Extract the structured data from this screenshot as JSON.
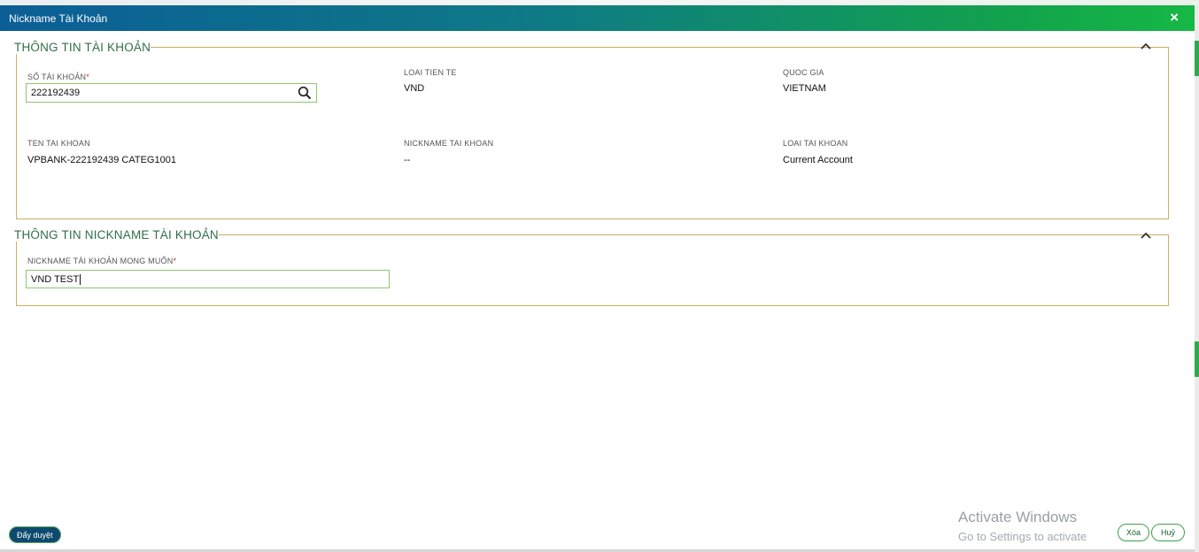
{
  "dialog": {
    "title": "Nickname Tài Khoản",
    "close_icon": "×"
  },
  "account_info": {
    "section_title": "THÔNG TIN TÀI KHOẢN",
    "account_number": {
      "label": "SỐ TÀI KHOẢN",
      "required_mark": "*",
      "value": "222192439"
    },
    "currency": {
      "label": "LOAI TIEN TE",
      "value": "VND"
    },
    "country": {
      "label": "QUOC GIA",
      "value": "VIETNAM"
    },
    "account_name": {
      "label": "TEN TAI KHOAN",
      "value": "VPBANK-222192439 CATEG1001"
    },
    "account_nickname": {
      "label": "NICKNAME TAI KHOAN",
      "value": "--"
    },
    "account_type": {
      "label": "LOAI TAI KHOAN",
      "value": "Current Account"
    }
  },
  "nickname_info": {
    "section_title": "THÔNG TIN NICKNAME TÀI KHOẢN",
    "desired_nickname": {
      "label": "NICKNAME TÀI KHOẢN MONG MUỐN",
      "required_mark": "*",
      "value": "VND TEST"
    }
  },
  "actions": {
    "submit_label": "Đẩy duyệt",
    "delete_label": "Xóa",
    "cancel_label": "Huỷ"
  },
  "watermark": {
    "title": "Activate Windows",
    "subtitle": "Go to Settings to activate"
  },
  "icons": {
    "collapse": "chevron-up-icon",
    "search": "search-icon",
    "close": "close-icon"
  },
  "colors": {
    "title_gradient_start": "#0b5e96",
    "title_gradient_end": "#16b845",
    "section_border": "#c9b062",
    "section_title": "#2f6f48",
    "input_border": "#8cc870",
    "required": "#d62b2b",
    "submit_button": "#0c4b6e"
  }
}
